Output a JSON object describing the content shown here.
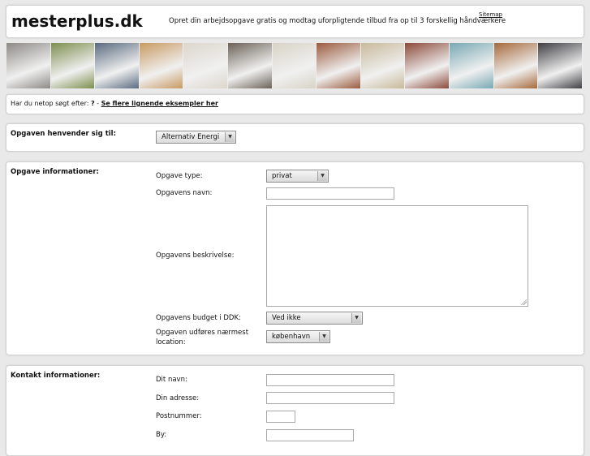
{
  "header": {
    "logo": "mesterplus.dk",
    "tagline": "Opret din arbejdsopgave gratis og modtag uforpligtende tilbud fra op til 3 forskellig håndværkere",
    "sitemap": "Sitemap"
  },
  "photos": [
    {
      "name": "paving-photo",
      "color": "#8d8a86"
    },
    {
      "name": "garden-photo",
      "color": "#7d8f4e"
    },
    {
      "name": "drilling-photo",
      "color": "#5a6b80"
    },
    {
      "name": "floor-photo",
      "color": "#c89a62"
    },
    {
      "name": "painting-photo",
      "color": "#dcd6cc"
    },
    {
      "name": "pipes-photo",
      "color": "#6b6257"
    },
    {
      "name": "ladder-photo",
      "color": "#d8d3c6"
    },
    {
      "name": "brick-photo",
      "color": "#9b5b3e"
    },
    {
      "name": "tools-photo",
      "color": "#c8b99a"
    },
    {
      "name": "roof-photo",
      "color": "#8c4a3a"
    },
    {
      "name": "house-photo",
      "color": "#78a8b4"
    },
    {
      "name": "carpenter-photo",
      "color": "#a66a3c"
    },
    {
      "name": "window-photo",
      "color": "#3f3f44"
    }
  ],
  "search": {
    "prefix": "Har du netop søgt efter: ",
    "query": "?",
    "separator": " - ",
    "link": "Se flere lignende eksempler her"
  },
  "category": {
    "label": "Opgaven henvender sig til:",
    "selected": "Alternativ Energi"
  },
  "details": {
    "label": "Opgave informationer:",
    "type_label": "Opgave type:",
    "type_value": "privat",
    "name_label": "Opgavens navn:",
    "name_value": "",
    "desc_label": "Opgavens beskrivelse:",
    "desc_value": "",
    "budget_label": "Opgavens budget i DDK:",
    "budget_value": "Ved ikke",
    "location_label": "Opgaven udføres nærmest location:",
    "location_value": "københavn"
  },
  "contact": {
    "label": "Kontakt informationer:",
    "name_label": "Dit navn:",
    "address_label": "Din adresse:",
    "zip_label": "Postnummer:",
    "city_label": "By:"
  }
}
